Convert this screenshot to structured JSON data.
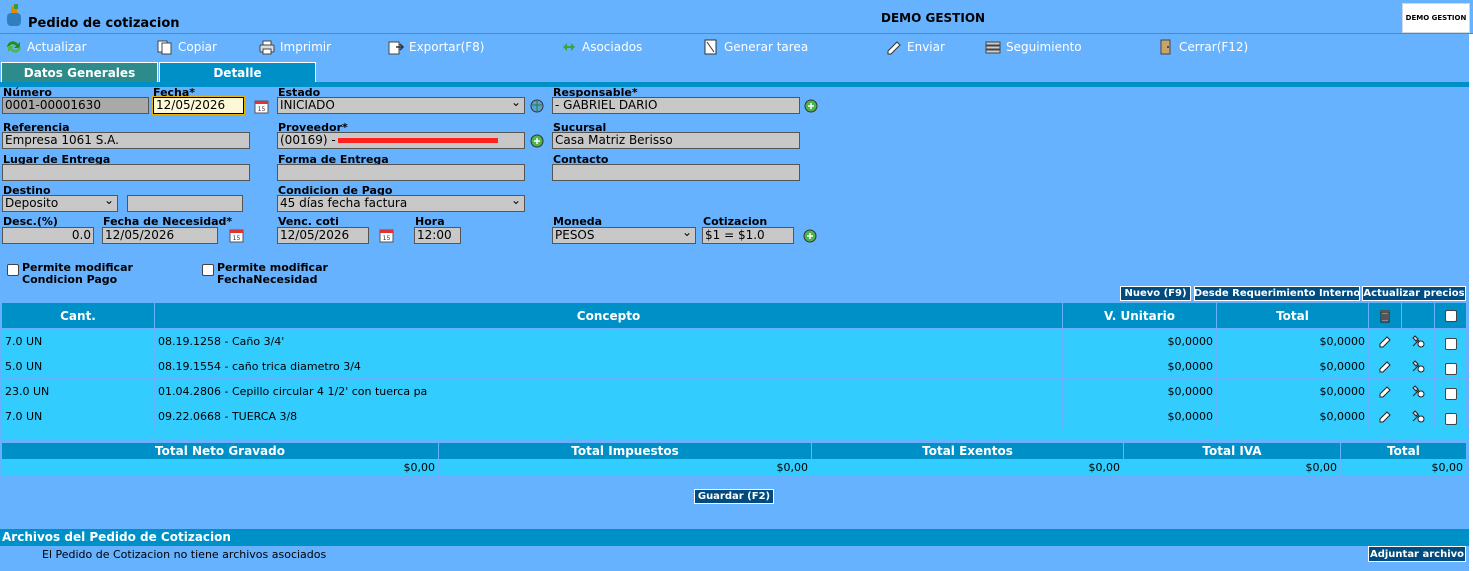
{
  "header": {
    "title": "Pedido de cotizacion",
    "company": "DEMO GESTION",
    "company_logo_text": "DEMO GESTION"
  },
  "toolbar": {
    "actualizar": "Actualizar",
    "copiar": "Copiar",
    "imprimir": "Imprimir",
    "exportar": "Exportar(F8)",
    "asociados": "Asociados",
    "generar_tarea": "Generar tarea",
    "enviar": "Enviar",
    "seguimiento": "Seguimiento",
    "cerrar": "Cerrar(F12)"
  },
  "tabs": {
    "datos": "Datos Generales",
    "detalle": "Detalle"
  },
  "form": {
    "numero_label": "Número",
    "numero": "0001-00001630",
    "fecha_label": "Fecha*",
    "fecha": "12/05/2026",
    "estado_label": "Estado",
    "estado": "INICIADO",
    "responsable_label": "Responsable*",
    "responsable": "- GABRIEL DARIO",
    "referencia_label": "Referencia",
    "referencia": "Empresa 1061 S.A.",
    "proveedor_label": "Proveedor*",
    "proveedor": "(00169) -",
    "sucursal_label": "Sucursal",
    "sucursal": "Casa Matriz Berisso",
    "lugar_label": "Lugar de Entrega",
    "lugar": "",
    "forma_label": "Forma de Entrega",
    "forma": "",
    "contacto_label": "Contacto",
    "contacto": "",
    "destino_label": "Destino",
    "destino": "Deposito",
    "destino_extra": "",
    "condicion_label": "Condicion de Pago",
    "condicion": "45 días fecha factura",
    "desc_label": "Desc.(%)",
    "desc": "0.0",
    "necesidad_label": "Fecha de Necesidad*",
    "necesidad": "12/05/2026",
    "venc_label": "Venc. coti",
    "venc": "12/05/2026",
    "hora_label": "Hora",
    "hora": "12:00",
    "moneda_label": "Moneda",
    "moneda": "PESOS",
    "cotizacion_label": "Cotizacion",
    "cotizacion": "$1 = $1.0",
    "chk_condicion_1": "Permite modificar",
    "chk_condicion_2": "Condicion Pago",
    "chk_fecha_1": "Permite modificar",
    "chk_fecha_2": "FechaNecesidad"
  },
  "actions": {
    "nuevo": "Nuevo (F9)",
    "desde_req": "Desde Requerimiento Interno",
    "actualizar_precios": "Actualizar precios",
    "guardar": "Guardar (F2)",
    "adjuntar": "Adjuntar archivo"
  },
  "grid": {
    "headers": {
      "cant": "Cant.",
      "concepto": "Concepto",
      "unitario": "V. Unitario",
      "total": "Total"
    },
    "rows": [
      {
        "cant": "7.0 UN",
        "concepto": "08.19.1258 - Caño 3/4'",
        "unitario": "$0,0000",
        "total": "$0,0000"
      },
      {
        "cant": "5.0 UN",
        "concepto": "08.19.1554 - caño trica diametro 3/4",
        "unitario": "$0,0000",
        "total": "$0,0000"
      },
      {
        "cant": "23.0 UN",
        "concepto": "01.04.2806 - Cepillo circular 4 1/2' con tuerca pa",
        "unitario": "$0,0000",
        "total": "$0,0000"
      },
      {
        "cant": "7.0 UN",
        "concepto": "09.22.0668 - TUERCA 3/8",
        "unitario": "$0,0000",
        "total": "$0,0000"
      }
    ]
  },
  "totals": {
    "neto_label": "Total Neto Gravado",
    "neto": "$0,00",
    "impuestos_label": "Total Impuestos",
    "impuestos": "$0,00",
    "exentos_label": "Total Exentos",
    "exentos": "$0,00",
    "iva_label": "Total IVA",
    "iva": "$0,00",
    "total_label": "Total",
    "total": "$0,00"
  },
  "files": {
    "title": "Archivos del Pedido de Cotizacion",
    "message": "El Pedido de Cotizacion no tiene archivos asociados"
  }
}
